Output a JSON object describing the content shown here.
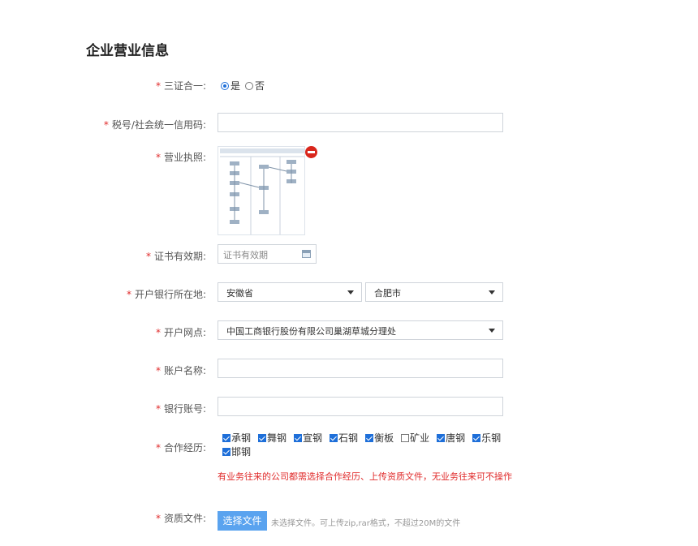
{
  "page_title": "企业营业信息",
  "required_mark": "*",
  "fields": {
    "three_in_one": {
      "label": "三证合一:",
      "options": [
        "是",
        "否"
      ],
      "selected": "是"
    },
    "tax_id": {
      "label": "税号/社会统一信用码:",
      "value": ""
    },
    "license": {
      "label": "营业执照:"
    },
    "cert_validity": {
      "label": "证书有效期:",
      "placeholder": "证书有效期"
    },
    "bank_location": {
      "label": "开户银行所在地:",
      "province": "安徽省",
      "city": "合肥市"
    },
    "bank_branch": {
      "label": "开户网点:",
      "value": "中国工商银行股份有限公司巢湖草城分理处"
    },
    "account_name": {
      "label": "账户名称:",
      "value": ""
    },
    "account_no": {
      "label": "银行账号:",
      "value": ""
    },
    "cooperation": {
      "label": "合作经历:",
      "items": [
        {
          "text": "承钢",
          "checked": true
        },
        {
          "text": "舞钢",
          "checked": true
        },
        {
          "text": "宣钢",
          "checked": true
        },
        {
          "text": "石钢",
          "checked": true
        },
        {
          "text": "衡板",
          "checked": true
        },
        {
          "text": "矿业",
          "checked": false
        },
        {
          "text": "唐钢",
          "checked": true
        },
        {
          "text": "乐钢",
          "checked": true
        },
        {
          "text": "邯钢",
          "checked": true
        }
      ]
    },
    "notice": "有业务往来的公司都需选择合作经历、上传资质文件，无业务往来可不操作",
    "qualification": {
      "label": "资质文件:",
      "button": "选择文件",
      "hint": "未选择文件。可上传zip,rar格式，不超过20M的文件"
    }
  },
  "colors": {
    "required": "#e02b2b",
    "accent": "#1e6fd9",
    "button": "#5aa3ef"
  },
  "icons": [
    "remove-icon",
    "calendar-icon",
    "chevron-down-icon"
  ]
}
